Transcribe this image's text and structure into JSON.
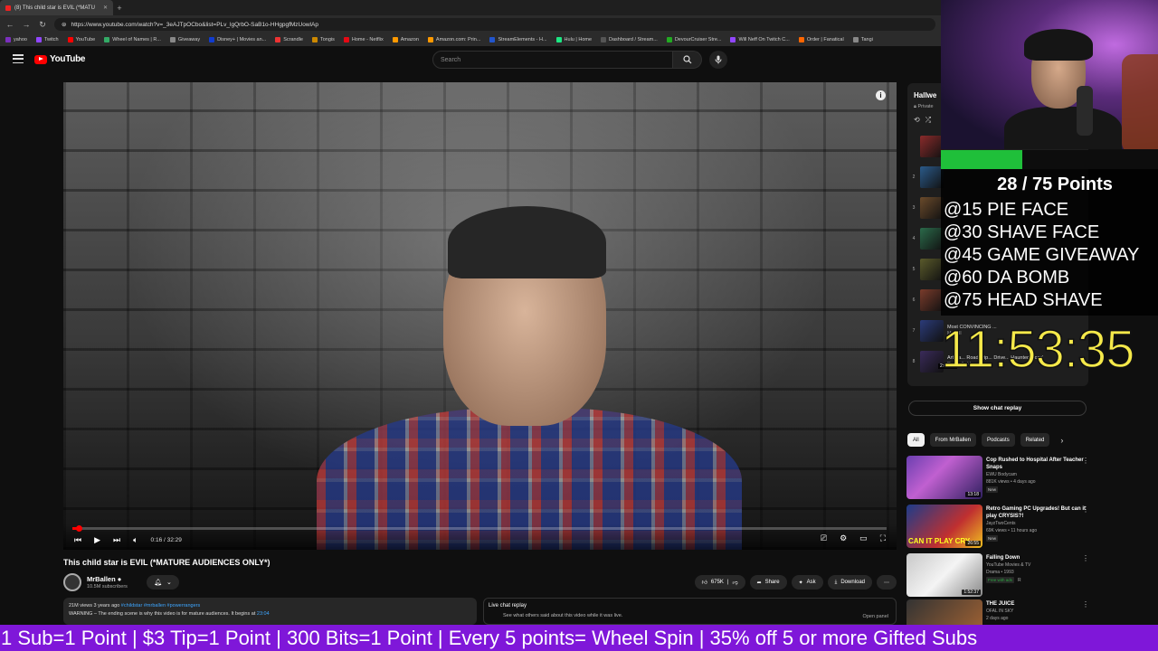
{
  "browser": {
    "tab_title": "(8) This child star is EVIL (*MATU",
    "url": "https://www.youtube.com/watch?v=_3eAJTpOCbo&list=PLv_lgQrbO-SaB1o-HHgpgfMzUowlAp",
    "bookmarks": [
      "yahoo",
      "Twitch",
      "YouTube",
      "Wheel of Names | R...",
      "Giveaway",
      "Disney+ | Movies an...",
      "Scrandle",
      "Tongis",
      "Home - Netflix",
      "Amazon",
      "Amazon.com: Prin...",
      "StreamElements - H...",
      "Hulu | Home",
      "Dashboard / Stream...",
      "DevourCruiser Stre...",
      "Will Neff On Twitch C...",
      "Order | Fanatical",
      "Tangi"
    ]
  },
  "youtube": {
    "logo": "YouTube",
    "search_placeholder": "Search"
  },
  "player": {
    "time": "0:16 / 32:29",
    "progress_fraction": 0.008
  },
  "video": {
    "title": "This child star is EVIL (*MATURE AUDIENCES ONLY*)",
    "channel": "MrBallen",
    "subscribers": "10.5M subscribers",
    "likes": "675K",
    "share": "Share",
    "ask": "Ask",
    "download": "Download",
    "desc_meta": "21M views  3 years ago",
    "desc_tags": "#childstar #mrballen #powerrangers",
    "desc_line2": "WARNING – The ending scene is why this video is for mature audiences. It begins at",
    "desc_link": "23:04"
  },
  "chat": {
    "title": "Live chat replay",
    "subtitle": "See what others said about this video while it was live.",
    "open_panel": "Open panel",
    "show_replay": "Show chat replay"
  },
  "playlist": {
    "title": "Hallwe",
    "privacy": "Private",
    "items": [
      {
        "idx": "",
        "text": "",
        "sub": ""
      },
      {
        "idx": "2",
        "text": "",
        "sub": ""
      },
      {
        "idx": "3",
        "text": "",
        "sub": ""
      },
      {
        "idx": "4",
        "text": "",
        "sub": ""
      },
      {
        "idx": "5",
        "text": "",
        "sub": ""
      },
      {
        "idx": "6",
        "text": "",
        "sub": ""
      },
      {
        "idx": "7",
        "text": "Most CONVINCING ...",
        "sub": "MrBall"
      },
      {
        "idx": "8",
        "text": "Art Ba... Road Trip... Drive... Haunted Road",
        "sub": "Russel's House"
      }
    ],
    "last_duration": "2:03:53"
  },
  "chips": [
    "All",
    "From MrBallen",
    "Podcasts",
    "Related"
  ],
  "recommendations": [
    {
      "title": "Cop Rushed to Hospital After Teacher Snaps",
      "channel": "EWU Bodycam",
      "stats": "881K views • 4 days ago",
      "badge": "New",
      "duration": "13:18"
    },
    {
      "title": "Retro Gaming PC Upgrades! But can it play CRYSIS?!",
      "channel": "JayzTwoCents",
      "stats": "69K views • 11 hours ago",
      "badge": "New",
      "duration": "26:55",
      "thumb_text": "CAN IT PLAY CRY"
    },
    {
      "title": "Falling Down",
      "channel": "YouTube Movies & TV",
      "stats": "Drama • 1993",
      "badge": "Free with ads",
      "rating": "R",
      "duration": "1:52:37"
    },
    {
      "title": "THE JUICE",
      "channel": "OFAL IN SKY",
      "stats": "2 days ago",
      "badge": "",
      "duration": ""
    }
  ],
  "overlay": {
    "points_title": "28 / 75 Points",
    "points_current": 28,
    "points_max": 75,
    "goals": [
      "@15 PIE FACE",
      "@30 SHAVE FACE",
      "@45 GAME GIVEAWAY",
      "@60 DA BOMB",
      "@75 HEAD SHAVE"
    ],
    "timer": "11:53:35",
    "ticker": "1 Sub=1 Point | $3 Tip=1 Point | 300 Bits=1 Point | Every 5 points= Wheel Spin | 35% off 5 or more Gifted Subs"
  },
  "colors": {
    "yt_red": "#ff0000",
    "points_green": "#1fbf3a",
    "timer_yellow": "#f5e94a",
    "ticker_purple": "#7f17d9"
  }
}
